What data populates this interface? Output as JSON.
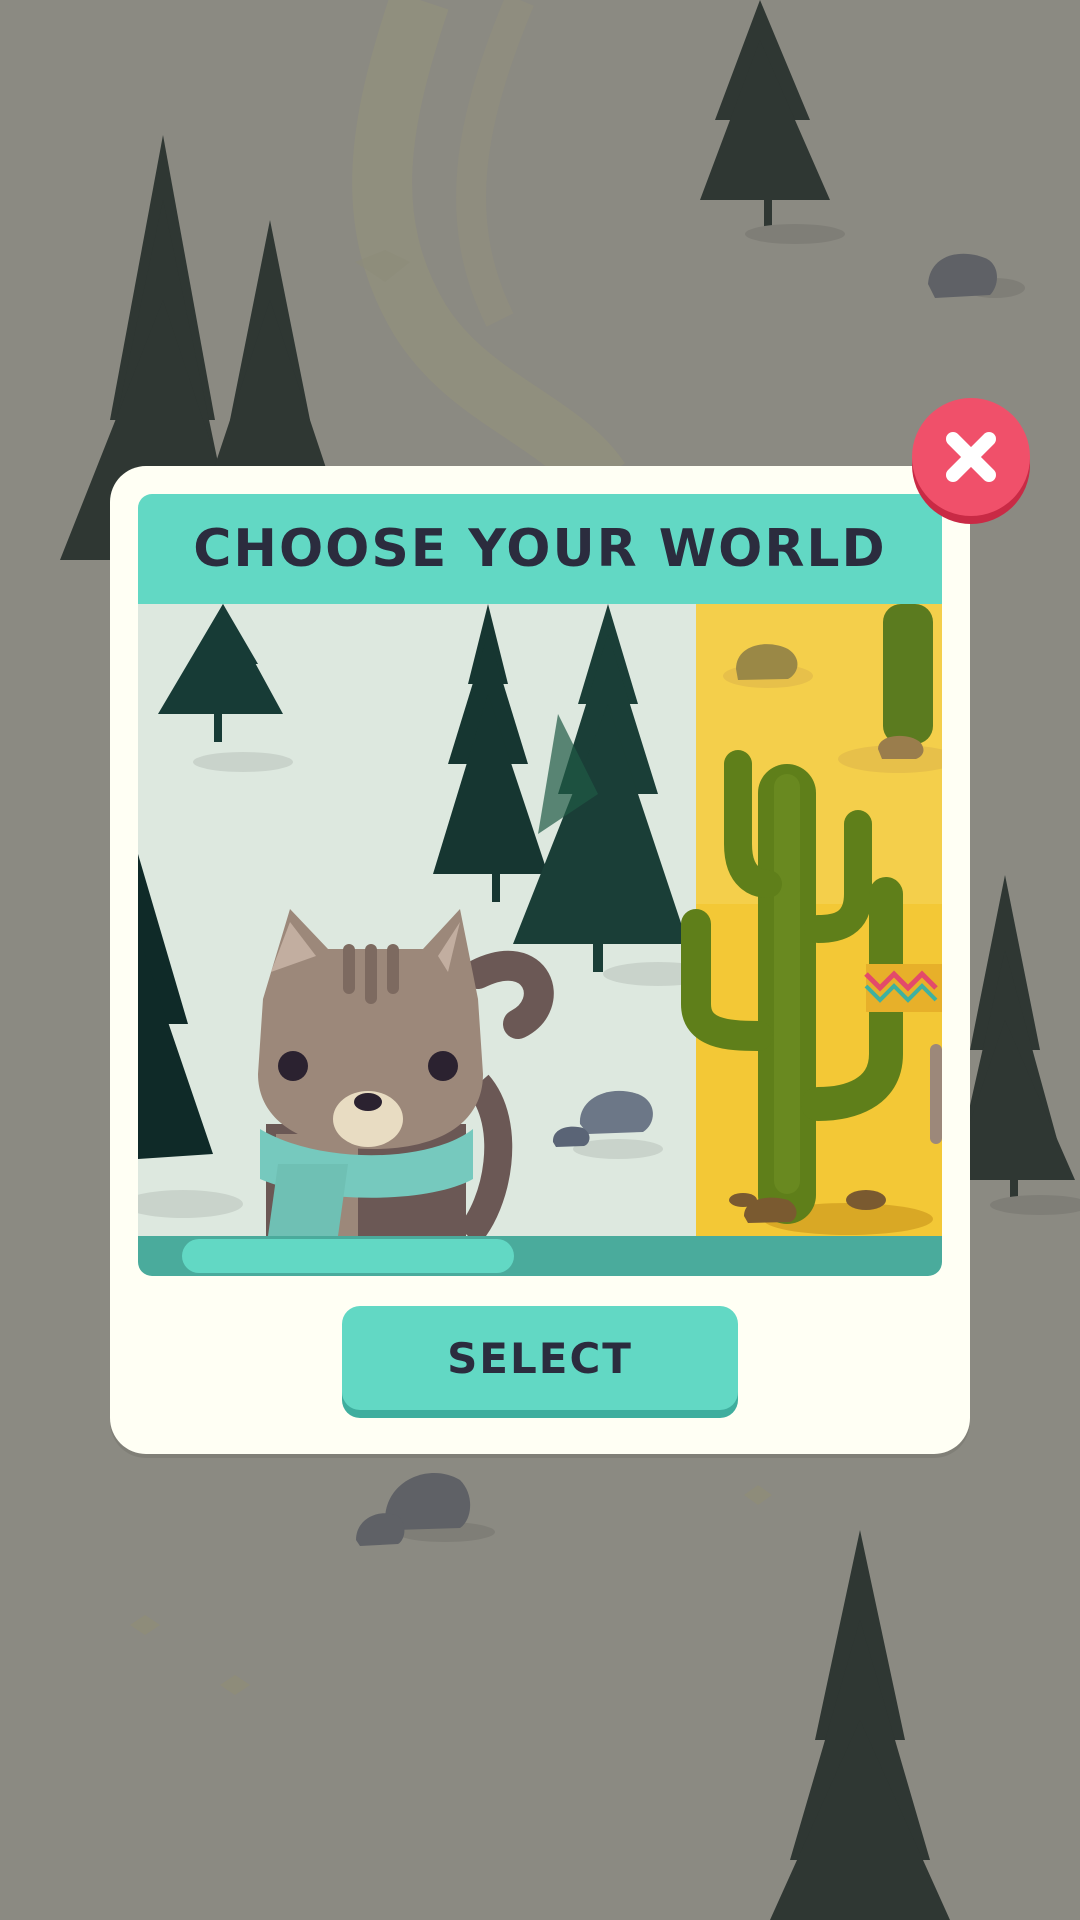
{
  "dialog": {
    "title": "CHOOSE YOUR WORLD",
    "select_label": "SELECT"
  },
  "icons": {
    "close": "close-icon"
  },
  "worlds": [
    {
      "name_hidden": false,
      "theme": "snow-forest"
    },
    {
      "name_hidden": false,
      "theme": "desert"
    }
  ],
  "carousel": {
    "visible_fraction_start": 0.0,
    "visible_fraction_end": 0.42
  },
  "colors": {
    "background": "#8b8a82",
    "accent": "#62d8c4",
    "close": "#f0506a",
    "text": "#2b2c3e",
    "panel": "#fffff4"
  }
}
